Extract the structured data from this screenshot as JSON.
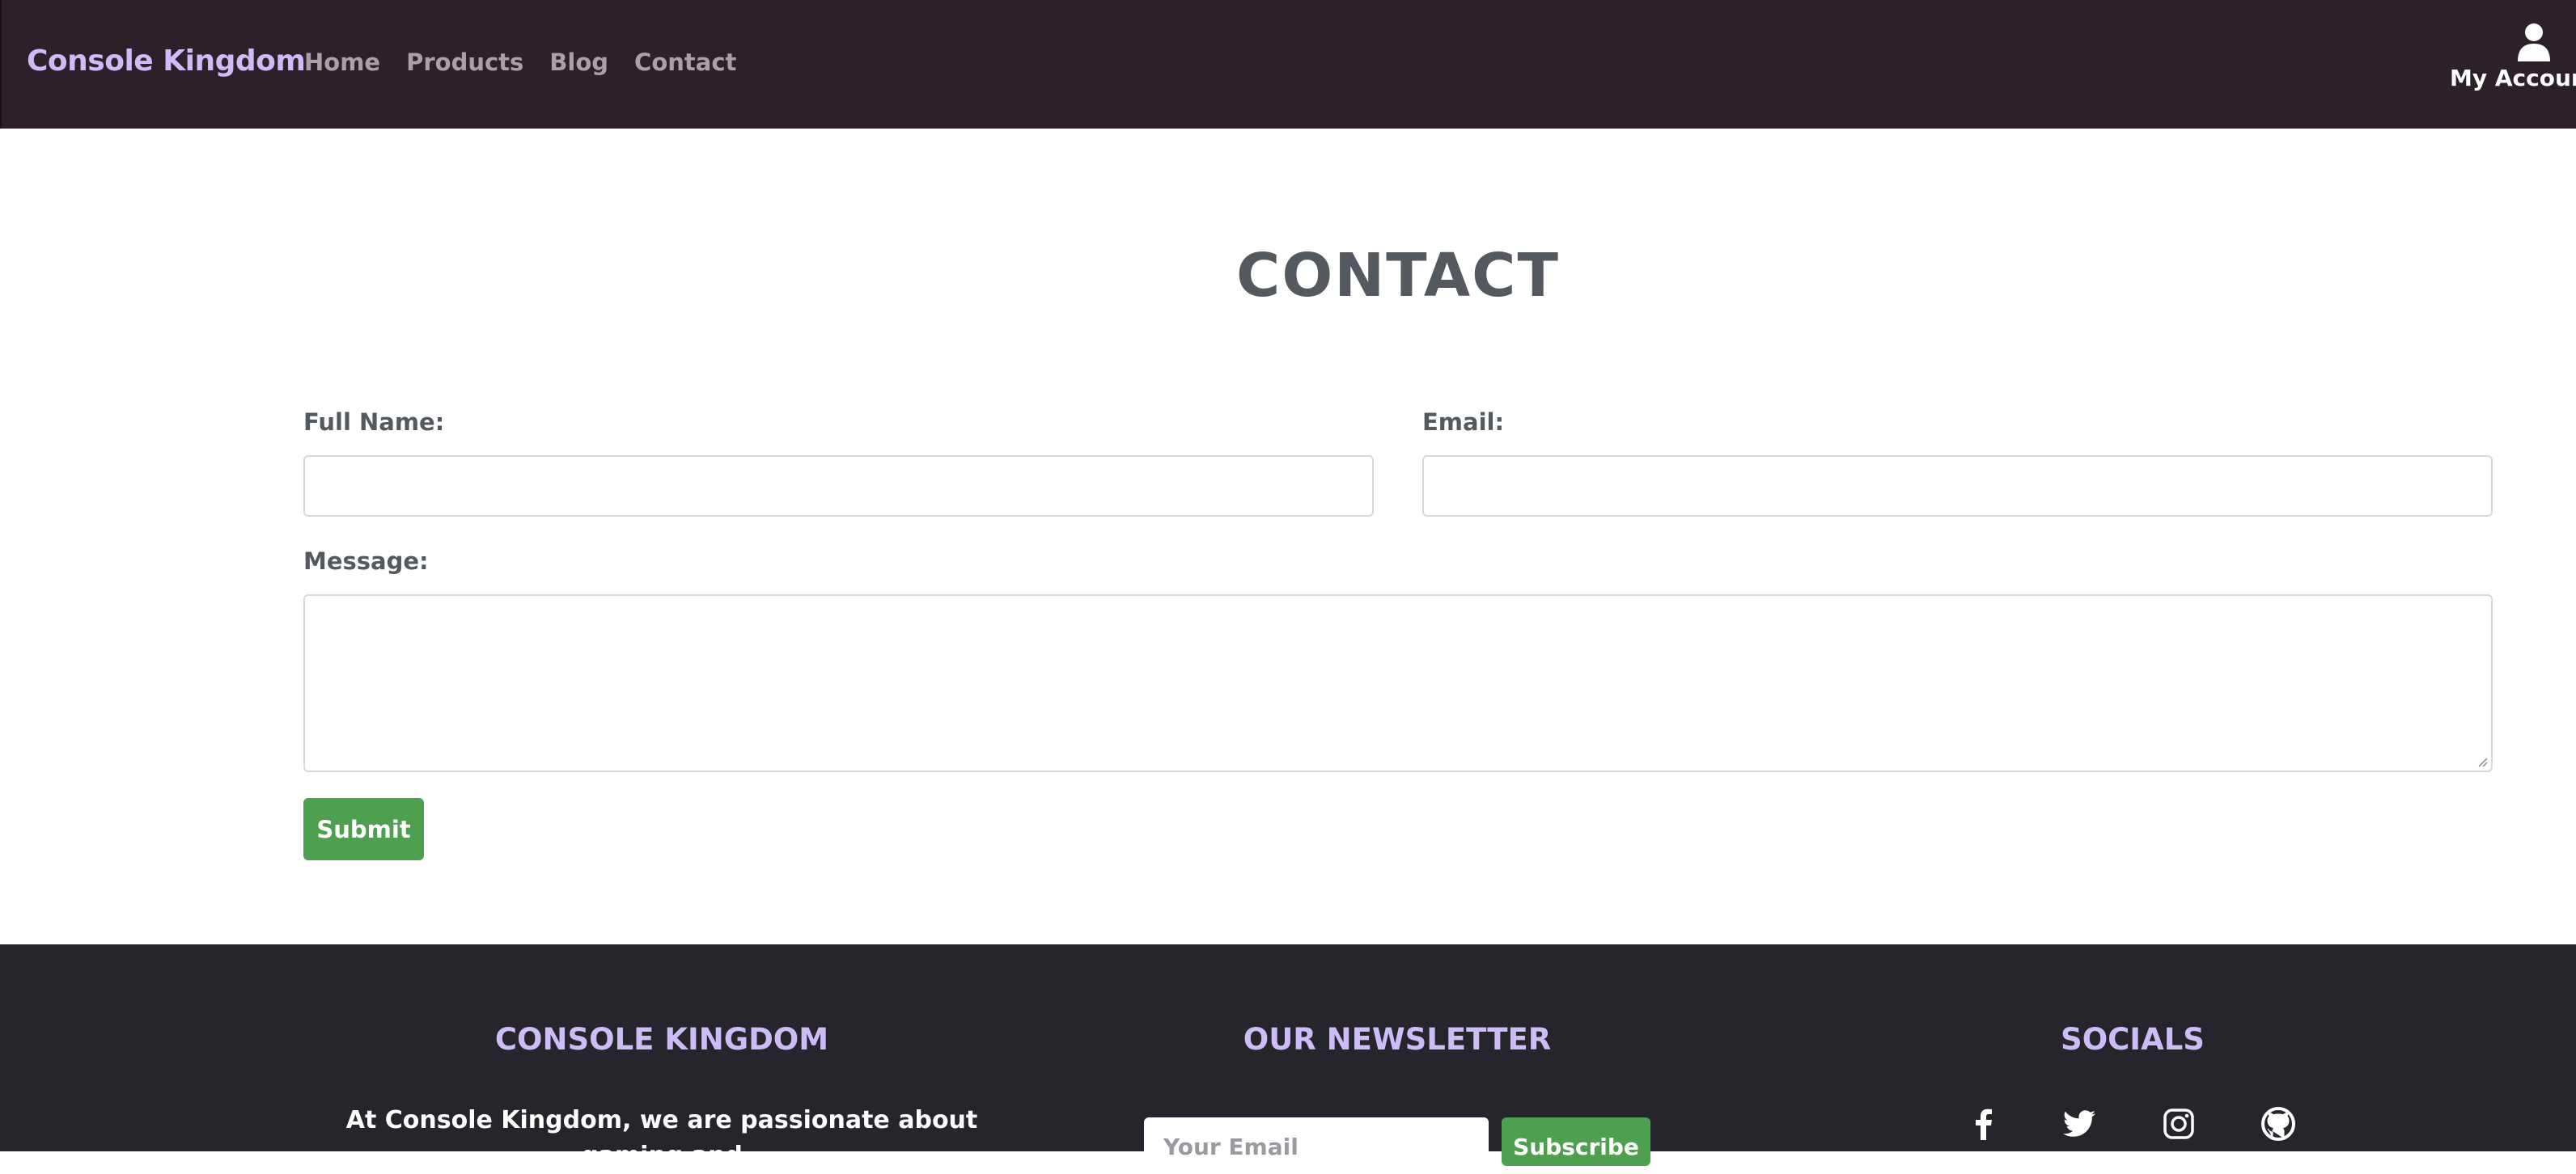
{
  "header": {
    "brand": "Console Kingdom",
    "nav": [
      "Home",
      "Products",
      "Blog",
      "Contact"
    ],
    "account_label": "My Account"
  },
  "main": {
    "title": "CONTACT",
    "form": {
      "full_name_label": "Full Name:",
      "full_name_value": "",
      "email_label": "Email:",
      "email_value": "",
      "message_label": "Message:",
      "message_value": "",
      "submit_label": "Submit"
    }
  },
  "footer": {
    "about": {
      "heading": "CONSOLE KINGDOM",
      "text": "At Console Kingdom, we are passionate about gaming and"
    },
    "newsletter": {
      "heading": "OUR NEWSLETTER",
      "email_placeholder": "Your Email",
      "subscribe_label": "Subscribe"
    },
    "socials": {
      "heading": "SOCIALS",
      "icons": [
        "facebook-icon",
        "twitter-icon",
        "instagram-icon",
        "github-icon"
      ]
    }
  },
  "colors": {
    "header_bg": "#2c2129",
    "brand": "#cdbcf7",
    "nav_text": "#a8a1a6",
    "heading_text": "#545960",
    "button_green": "#4e9f4f",
    "footer_bg": "#25252b"
  }
}
